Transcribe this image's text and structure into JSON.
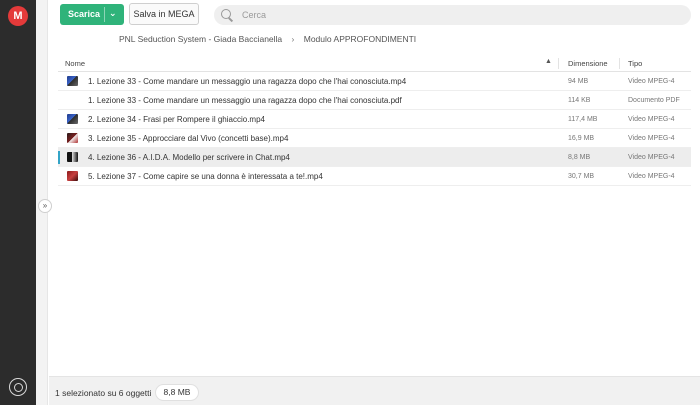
{
  "app": {
    "logo_letter": "M"
  },
  "toolbar": {
    "download_label": "Scarica",
    "download_chevron": "⌄",
    "save_label": "Salva in MEGA",
    "search_placeholder": "Cerca"
  },
  "breadcrumb": {
    "items": [
      "PNL Seduction System - Giada Baccianella",
      "Modulo APPROFONDIMENTI"
    ],
    "separator": "›"
  },
  "table": {
    "headers": {
      "name": "Nome",
      "size": "Dimensione",
      "type": "Tipo"
    },
    "sort_indicator": "▲",
    "rows": [
      {
        "name": "1. Lezione 33 - Come mandare un messaggio una ragazza dopo che l'hai conosciuta.mp4",
        "size": "94 MB",
        "type": "Video MPEG-4",
        "thumb": "blue",
        "selected": false
      },
      {
        "name": "1. Lezione 33 - Come mandare un messaggio una ragazza dopo che l'hai conosciuta.pdf",
        "size": "114 KB",
        "type": "Documento PDF",
        "thumb": "none",
        "selected": false
      },
      {
        "name": "2. Lezione 34 - Frasi per Rompere il ghiaccio.mp4",
        "size": "117,4 MB",
        "type": "Video MPEG-4",
        "thumb": "blue",
        "selected": false
      },
      {
        "name": "3. Lezione 35 - Approcciare dal Vivo (concetti base).mp4",
        "size": "16,9 MB",
        "type": "Video MPEG-4",
        "thumb": "dark",
        "selected": false
      },
      {
        "name": "4. Lezione 36 - A.I.D.A. Modello per scrivere in Chat.mp4",
        "size": "8,8 MB",
        "type": "Video MPEG-4",
        "thumb": "black",
        "selected": true
      },
      {
        "name": "5. Lezione 37 - Come capire se una donna è interessata a te!.mp4",
        "size": "30,7 MB",
        "type": "Video MPEG-4",
        "thumb": "red",
        "selected": false
      }
    ]
  },
  "status": {
    "selection_text": "1 selezionato su 6 oggetti",
    "selection_size": "8,8 MB"
  },
  "sidebar": {
    "toggle_glyph": "»"
  },
  "colors": {
    "accent_green": "#2fb37a",
    "brand_red": "#e43a3a",
    "rail_dark": "#2c2c2c",
    "selection_marker": "#33a4c7"
  }
}
